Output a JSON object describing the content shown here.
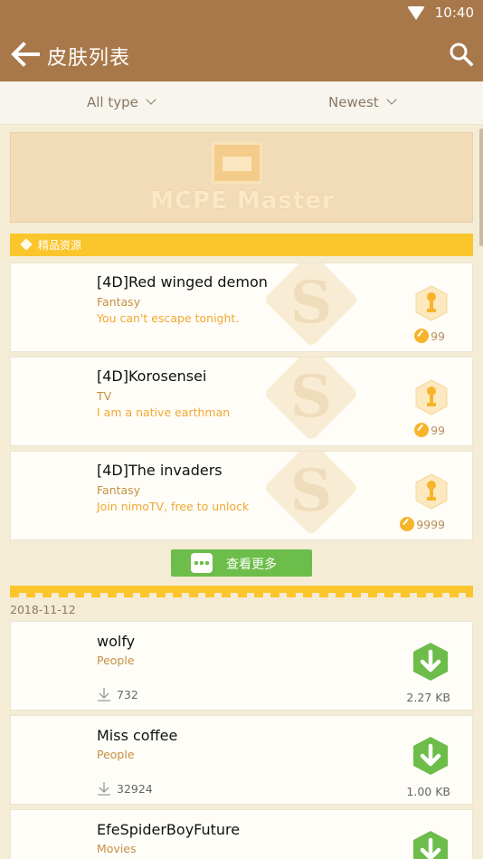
{
  "status_bar": {
    "time": "10:40"
  },
  "app_bar": {
    "title": "皮肤列表"
  },
  "filters": {
    "type_label": "All type",
    "sort_label": "Newest"
  },
  "banner": {
    "logo_text": "MCPE Master"
  },
  "premium": {
    "header_label": "精品资源",
    "items": [
      {
        "name": "[4D]Red winged demon",
        "category": "Fantasy",
        "description": "You can't escape tonight.",
        "price": "99"
      },
      {
        "name": "[4D]Korosensei",
        "category": "TV",
        "description": "I am a native earthman",
        "price": "99"
      },
      {
        "name": "[4D]The invaders",
        "category": "Fantasy",
        "description": "Join nimoTV, free to unlock",
        "price": "9999"
      }
    ],
    "more_button_label": "查看更多"
  },
  "recent": {
    "date": "2018-11-12",
    "items": [
      {
        "name": "wolfy",
        "category": "People",
        "downloads": "732",
        "size": "2.27 KB"
      },
      {
        "name": "Miss coffee",
        "category": "People",
        "downloads": "32924",
        "size": "1.00 KB"
      },
      {
        "name": "EfeSpiderBoyFuture",
        "category": "Movies",
        "downloads": "",
        "size": ""
      }
    ]
  },
  "colors": {
    "app_bar": "#a8784a",
    "accent_yellow": "#fbc62c",
    "green": "#6cbd4a",
    "category": "#c69042",
    "description": "#f0a830"
  }
}
